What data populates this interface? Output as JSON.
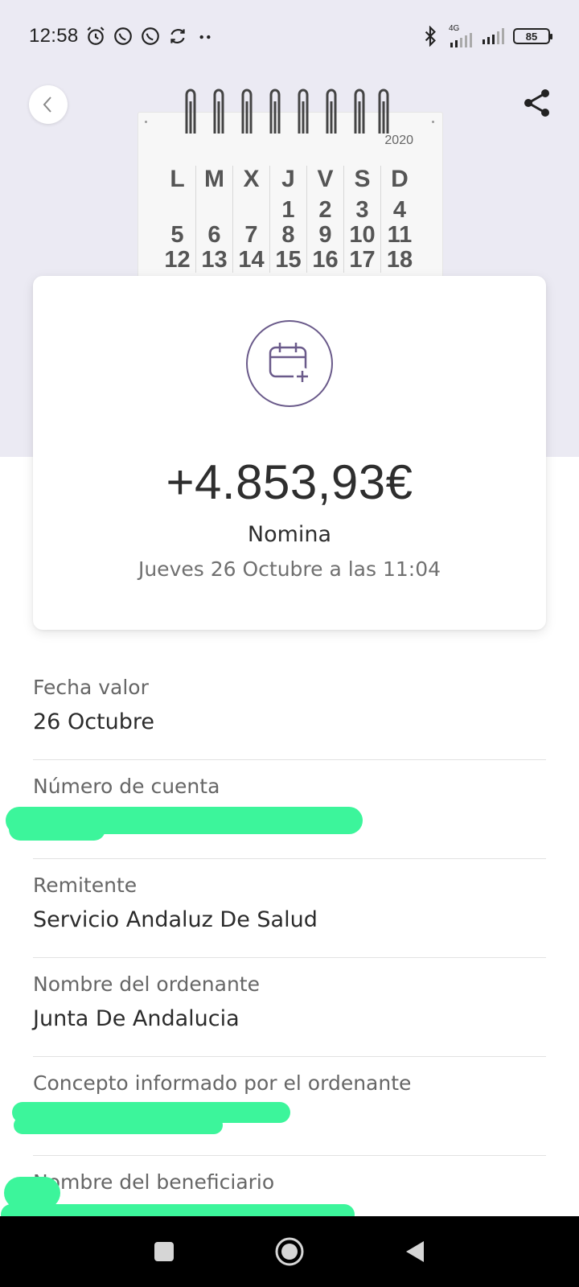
{
  "status_bar": {
    "time": "12:58",
    "network_label": "4G",
    "battery": "85",
    "icons": [
      "alarm-icon",
      "whatsapp-icon",
      "whatsapp-icon",
      "sync-icon",
      "more-dots-icon",
      "bluetooth-icon",
      "signal-icon",
      "signal-icon"
    ]
  },
  "header": {
    "back_icon": "chevron-left-icon",
    "share_icon": "share-icon"
  },
  "calendar": {
    "year": "2020",
    "days": [
      "L",
      "M",
      "X",
      "J",
      "V",
      "S",
      "D"
    ],
    "rows": [
      [
        "",
        "",
        "",
        "1",
        "2",
        "3",
        "4"
      ],
      [
        "5",
        "6",
        "7",
        "8",
        "9",
        "10",
        "11"
      ],
      [
        "12",
        "13",
        "14",
        "15",
        "16",
        "17",
        "18"
      ]
    ]
  },
  "transaction": {
    "icon": "calendar-add-icon",
    "amount": "+4.853,93€",
    "concept": "Nomina",
    "datetime": "Jueves 26 Octubre a las 11:04"
  },
  "details": [
    {
      "label": "Fecha valor",
      "value": "26 Octubre"
    },
    {
      "label": "Número de cuenta",
      "value": ""
    },
    {
      "label": "Remitente",
      "value": "Servicio Andaluz De Salud"
    },
    {
      "label": "Nombre del ordenante",
      "value": "Junta De Andalucia"
    },
    {
      "label": "Concepto informado por el ordenante",
      "value": ""
    },
    {
      "label": "Nombre del beneficiario",
      "value": ""
    }
  ],
  "colors": {
    "header_bg": "#ebeaf3",
    "accent": "#6a5a8a",
    "redaction": "#3cf59b"
  },
  "nav": {
    "icons": [
      "recents-square-icon",
      "home-circle-icon",
      "back-triangle-icon"
    ]
  }
}
